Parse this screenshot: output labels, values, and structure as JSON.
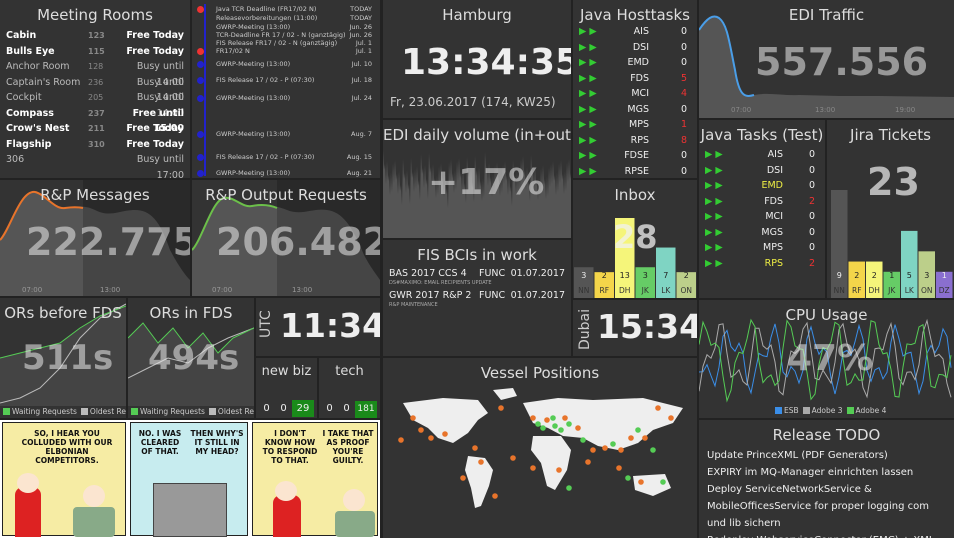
{
  "meeting_rooms": {
    "title": "Meeting Rooms",
    "rows": [
      {
        "name": "Cabin",
        "num": "123",
        "status": "Free Today",
        "free": true
      },
      {
        "name": "Bulls Eye",
        "num": "115",
        "status": "Free Today",
        "free": true
      },
      {
        "name": "Anchor Room",
        "num": "128",
        "status": "Busy until 14:00",
        "free": false
      },
      {
        "name": "Captain's Room",
        "num": "236",
        "status": "Busy until 14:00",
        "free": false
      },
      {
        "name": "Cockpit",
        "num": "205",
        "status": "Busy until 14:00",
        "free": false
      },
      {
        "name": "Compass",
        "num": "237",
        "status": "Free until 15:00",
        "free": true
      },
      {
        "name": "Crow's Nest",
        "num": "211",
        "status": "Free Today",
        "free": true
      },
      {
        "name": "Flagship",
        "num": "310",
        "status": "Free Today",
        "free": true
      },
      {
        "name": "306",
        "num": "",
        "status": "Busy until 17:00",
        "free": false
      }
    ]
  },
  "calendar": [
    {
      "t": "Java TCR Deadline (FR17/02 N)",
      "d": "TODAY",
      "c": "#e33"
    },
    {
      "t": "Releasevorbereitungen (11:00)",
      "d": "TODAY",
      "c": ""
    },
    {
      "t": "GWRP-Meeting (13:00)",
      "d": "Jun. 26",
      "c": ""
    },
    {
      "t": "TCR-Deadline FR 17 / 02 - N (ganztägig)",
      "d": "Jun. 26",
      "c": ""
    },
    {
      "t": "FIS Release FR17 / 02 - N (ganztägig)",
      "d": "Jul. 1",
      "c": ""
    },
    {
      "t": "FR17/02 N",
      "d": "Jul. 1",
      "c": "#e33"
    },
    {
      "t": "GWRP-Meeting (13:00)",
      "d": "Jul. 10",
      "c": "#22c"
    },
    {
      "t": "FIS Release 17 / 02 - P (07:30)",
      "d": "Jul. 18",
      "c": "#22c"
    },
    {
      "t": "GWRP-Meeting (13:00)",
      "d": "Jul. 24",
      "c": "#22c"
    },
    {
      "t": "GWRP-Meeting (13:00)",
      "d": "Aug. 7",
      "c": "#22c"
    },
    {
      "t": "FIS Release 17 / 02 - P (07:30)",
      "d": "Aug. 15",
      "c": "#22c"
    },
    {
      "t": "GWRP-Meeting (13:00)",
      "d": "Aug. 21",
      "c": "#22c"
    }
  ],
  "hamburg": {
    "title": "Hamburg",
    "time": "13:34:35",
    "date": "Fr, 23.06.2017 (174, KW25)"
  },
  "java_hosttasks": {
    "title": "Java Hosttasks",
    "rows": [
      {
        "n": "AIS",
        "v": "0",
        "red": false
      },
      {
        "n": "DSI",
        "v": "0",
        "red": false
      },
      {
        "n": "EMD",
        "v": "0",
        "red": false
      },
      {
        "n": "FDS",
        "v": "5",
        "red": true
      },
      {
        "n": "MCI",
        "v": "4",
        "red": true
      },
      {
        "n": "MGS",
        "v": "0",
        "red": false
      },
      {
        "n": "MPS",
        "v": "1",
        "red": true
      },
      {
        "n": "RPS",
        "v": "8",
        "red": true
      },
      {
        "n": "FDSE",
        "v": "0",
        "red": false
      },
      {
        "n": "RPSE",
        "v": "0",
        "red": false
      }
    ]
  },
  "edi_traffic": {
    "title": "EDI Traffic",
    "value": "557.556",
    "ticks": [
      "07:00",
      "13:00",
      "19:00"
    ]
  },
  "edi_volume": {
    "title": "EDI daily volume (in+out)",
    "value": "+17%"
  },
  "java_tasks_test": {
    "title": "Java Tasks (Test)",
    "rows": [
      {
        "n": "AIS",
        "v": "0",
        "c": "#eee"
      },
      {
        "n": "DSI",
        "v": "0",
        "c": "#eee"
      },
      {
        "n": "EMD",
        "v": "0",
        "c": "#ee4"
      },
      {
        "n": "FDS",
        "v": "2",
        "c": "#eee",
        "vc": "#e33"
      },
      {
        "n": "MCI",
        "v": "0",
        "c": "#eee"
      },
      {
        "n": "MGS",
        "v": "0",
        "c": "#eee"
      },
      {
        "n": "MPS",
        "v": "0",
        "c": "#eee"
      },
      {
        "n": "RPS",
        "v": "2",
        "c": "#ee4",
        "vc": "#e33"
      }
    ]
  },
  "jira": {
    "title": "Jira Tickets",
    "value": "23",
    "chart_data": {
      "type": "bar",
      "categories": [
        "NN",
        "RF",
        "DH",
        "JK",
        "LK",
        "ON",
        "DZ"
      ],
      "values": [
        9,
        2,
        2,
        1,
        5,
        3,
        1
      ],
      "colors": [
        "#555",
        "#f4d54a",
        "#f5f57a",
        "#66cc66",
        "#7fd4c3",
        "#bccf8a",
        "#8a6fcf"
      ]
    }
  },
  "inbox": {
    "title": "Inbox",
    "value": "28",
    "chart_data": {
      "type": "bar",
      "categories": [
        "NN",
        "RF",
        "DH",
        "JK",
        "LK",
        "ON"
      ],
      "values": [
        3,
        2,
        13,
        3,
        7,
        2
      ],
      "colors": [
        "#555",
        "#f4d54a",
        "#f5f57a",
        "#66cc66",
        "#7fd4c3",
        "#bccf8a"
      ]
    }
  },
  "rp_messages": {
    "title": "R&P Messages",
    "value": "222.775",
    "ticks": [
      "07:00",
      "13:00"
    ]
  },
  "rp_output": {
    "title": "R&P Output Requests",
    "value": "206.482",
    "ticks": [
      "07:00",
      "13:00"
    ]
  },
  "fis_bcis": {
    "title": "FIS BCIs in work",
    "rows": [
      {
        "name": "BAS 2017 CCS 4",
        "type": "FUNC",
        "date": "01.07.2017",
        "sub": "DS#MAXIMO: EMAIL RECIPIENTS UPDATE"
      },
      {
        "name": "GWR 2017 R&P 2",
        "type": "FUNC",
        "date": "01.07.2017",
        "sub": "R&P MAINTENANCE"
      }
    ]
  },
  "ors_fds": {
    "title": "ORs before FDS",
    "value": "511s",
    "legend": [
      "Waiting Requests",
      "Oldest Reque"
    ]
  },
  "ors_in_fds": {
    "title": "ORs in FDS",
    "value": "494s",
    "legend": [
      "Waiting Requests",
      "Oldest Reque"
    ]
  },
  "utc": {
    "label": "UTC",
    "time": "11:34"
  },
  "dubai": {
    "label": "Dubai",
    "time": "15:34"
  },
  "newbiz": {
    "title": "new biz",
    "cells": [
      "0",
      "0",
      "29"
    ]
  },
  "tech": {
    "title": "tech",
    "cells": [
      "0",
      "0",
      "181"
    ]
  },
  "cpu": {
    "title": "CPU Usage",
    "value": "47%",
    "legend": [
      "ESB",
      "Adobe 3",
      "Adobe 4"
    ]
  },
  "vessels": {
    "title": "Vessel Positions"
  },
  "release": {
    "title": "Release TODO",
    "items": [
      "Update PrinceXML (PDF Generators)",
      "EXPIRY im MQ-Manager einrichten lassen",
      "Deploy ServiceNetworkService & MobileOfficesService for proper logging com und lib sichern",
      "Redeploy WebserviceConnector (EMC) + XML"
    ]
  },
  "comic": {
    "p1": "SO, I HEAR YOU COLLUDED WITH OUR ELBONIAN COMPETITORS.",
    "p2a": "NO. I WAS CLEARED OF THAT.",
    "p2b": "THEN WHY'S IT STILL IN MY HEAD?",
    "p3a": "I DON'T KNOW HOW TO RESPOND TO THAT.",
    "p3b": "I TAKE THAT AS PROOF YOU'RE GUILTY."
  }
}
